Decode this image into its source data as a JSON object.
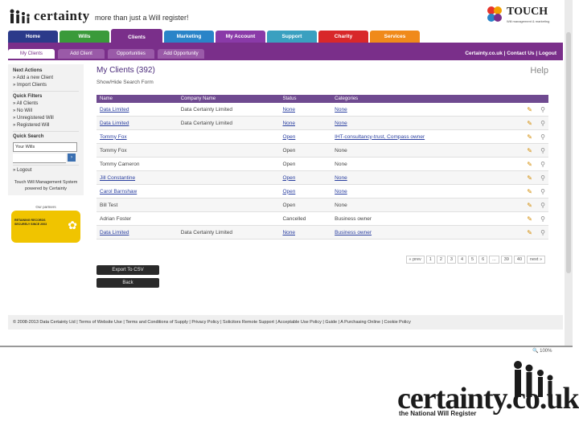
{
  "header": {
    "logo": "certainty",
    "tagline": "more than just a Will register!",
    "partner_logo": "TOUCH",
    "partner_sub": "Will management & marketing"
  },
  "nav": {
    "tabs": [
      {
        "label": "Home",
        "color": "#2b3a8a"
      },
      {
        "label": "Wills",
        "color": "#3a9a3a"
      },
      {
        "label": "Clients",
        "color": "#7a2f8a"
      },
      {
        "label": "Marketing",
        "color": "#2a84c8"
      },
      {
        "label": "My Account",
        "color": "#8a3aa8"
      },
      {
        "label": "Support",
        "color": "#3aa0c0"
      },
      {
        "label": "Charity",
        "color": "#d8282a"
      },
      {
        "label": "Services",
        "color": "#f08a1a"
      }
    ],
    "active": "Clients"
  },
  "subnav": {
    "tabs": [
      "My Clients",
      "Add Client",
      "Opportunities",
      "Add Opportunity"
    ],
    "links": "Certainty.co.uk | Contact Us | Logout"
  },
  "sidebar": {
    "next_actions_title": "Next Actions",
    "next_actions": [
      "» Add a new Client",
      "» Import Clients"
    ],
    "quick_filters_title": "Quick Filters",
    "quick_filters": [
      "» All Clients",
      "» No Will",
      "» Unregistered Will",
      "» Registered Will"
    ],
    "quick_search_title": "Quick Search",
    "search_select": "Your Wills",
    "search_go": "›",
    "logout": "» Logout",
    "powered": "Touch Will Management System powered by Certainty",
    "badge_caption": "Our partners",
    "badge_text": "RETAINING RECORDS SECURELY SINCE 2003",
    "badge_knot": "✿"
  },
  "main": {
    "title": "My Clients (392)",
    "help": "Help",
    "show_hide": "Show/Hide Search Form",
    "columns": [
      "Name",
      "Company Name",
      "Status",
      "Categories"
    ],
    "rows": [
      {
        "name": "Data Limited",
        "company": "Data Certainty Limited",
        "status": "None",
        "category": "None",
        "linked": true
      },
      {
        "name": "Data Limited",
        "company": "Data Certainty Limited",
        "status": "None",
        "category": "None",
        "linked": true
      },
      {
        "name": "Tommy Fox",
        "company": "",
        "status": "Open",
        "category": "IHT-consultancy-trust, Compass owner",
        "linked": true
      },
      {
        "name": "Tommy Fox",
        "company": "",
        "status": "Open",
        "category": "None",
        "linked": false
      },
      {
        "name": "Tommy Cameron",
        "company": "",
        "status": "Open",
        "category": "None",
        "linked": false
      },
      {
        "name": "Jill Constantine",
        "company": "",
        "status": "Open",
        "category": "None",
        "linked": true
      },
      {
        "name": "Carol Barnshaw",
        "company": "",
        "status": "Open",
        "category": "None",
        "linked": true
      },
      {
        "name": "Bill Test",
        "company": "",
        "status": "Open",
        "category": "None",
        "linked": false
      },
      {
        "name": "Adrian Foster",
        "company": "",
        "status": "Cancelled",
        "category": "Business owner",
        "linked": false
      },
      {
        "name": "Data Limited",
        "company": "Data Certainty Limited",
        "status": "None",
        "category": "Business owner",
        "linked": true
      }
    ],
    "pager": [
      "« prev",
      "1",
      "2",
      "3",
      "4",
      "5",
      "6",
      "...",
      "39",
      "40",
      "next »"
    ]
  },
  "buttons": {
    "export": "Export To CSV",
    "back": "Back"
  },
  "footer": "© 2008-2013 Data Certainty Ltd | Terms of Website Use | Terms and Conditions of Supply | Privacy Policy | Solicitors Remote Support | Acceptable Use Policy | Guide | A Purchasing Online | Cookie Policy",
  "status_bar": {
    "zoom": "🔍 100%"
  },
  "brand": {
    "name": "certainty.co.uk",
    "tagline": "the National Will Register"
  }
}
